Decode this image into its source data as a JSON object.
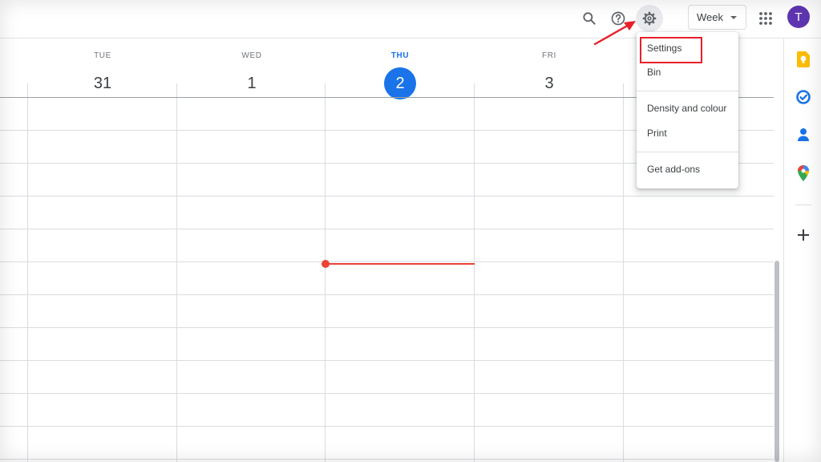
{
  "toolbar": {
    "search_icon": "search-icon",
    "help_icon": "help-icon",
    "settings_icon": "gear-icon",
    "view_label": "Week",
    "apps_icon": "apps-grid-icon",
    "avatar_initial": "T"
  },
  "days": [
    {
      "name": "TUE",
      "number": "31",
      "today": false
    },
    {
      "name": "WED",
      "number": "1",
      "today": false
    },
    {
      "name": "THU",
      "number": "2",
      "today": true
    },
    {
      "name": "FRI",
      "number": "3",
      "today": false
    }
  ],
  "settings_menu": {
    "items": [
      {
        "label": "Settings"
      },
      {
        "label": "Bin"
      },
      {
        "label": "Density and colour"
      },
      {
        "label": "Print"
      },
      {
        "label": "Get add-ons"
      }
    ]
  },
  "side_panel": {
    "icons": [
      "keep-icon",
      "tasks-icon",
      "contacts-icon",
      "maps-icon",
      "add-icon"
    ]
  },
  "colors": {
    "accent": "#1a73e8",
    "current_time": "#ea4335",
    "avatar": "#5e35b1",
    "annotation": "#e8202a"
  }
}
